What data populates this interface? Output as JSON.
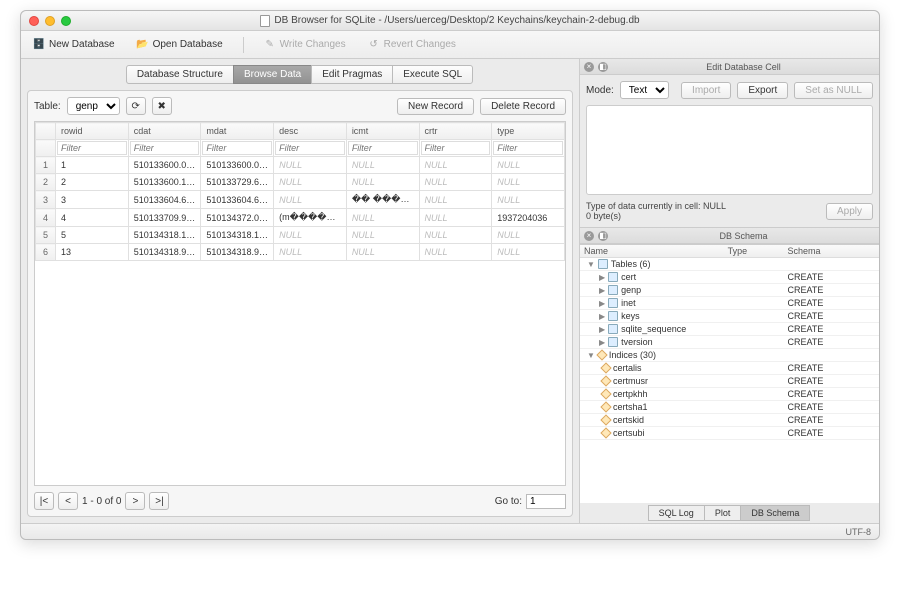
{
  "window": {
    "title": "DB Browser for SQLite - /Users/uerceg/Desktop/2 Keychains/keychain-2-debug.db"
  },
  "toolbar": {
    "new_db": "New Database",
    "open_db": "Open Database",
    "write_changes": "Write Changes",
    "revert_changes": "Revert Changes"
  },
  "tabs": {
    "structure": "Database Structure",
    "browse": "Browse Data",
    "pragmas": "Edit Pragmas",
    "sql": "Execute SQL"
  },
  "browse": {
    "table_label": "Table:",
    "table_selected": "genp",
    "new_record": "New Record",
    "delete_record": "Delete Record",
    "filter_placeholder": "Filter",
    "columns": [
      "rowid",
      "cdat",
      "mdat",
      "desc",
      "icmt",
      "crtr",
      "type"
    ],
    "rows": [
      {
        "idx": "1",
        "rowid": "1",
        "cdat": "510133600.06…",
        "mdat": "510133600.06…",
        "desc": null,
        "icmt": null,
        "crtr": null,
        "type": null
      },
      {
        "idx": "2",
        "rowid": "2",
        "cdat": "510133600.18…",
        "mdat": "510133729.60…",
        "desc": null,
        "icmt": null,
        "crtr": null,
        "type": null
      },
      {
        "idx": "3",
        "rowid": "3",
        "cdat": "510133604.63…",
        "mdat": "510133604.63…",
        "desc": null,
        "icmt": "�� �����z…",
        "crtr": null,
        "type": null
      },
      {
        "idx": "4",
        "rowid": "4",
        "cdat": "510133709.96…",
        "mdat": "510134372.06…",
        "desc": "(m����� �…",
        "icmt": null,
        "crtr": null,
        "type": "1937204036"
      },
      {
        "idx": "5",
        "rowid": "5",
        "cdat": "510134318.14…",
        "mdat": "510134318.14…",
        "desc": null,
        "icmt": null,
        "crtr": null,
        "type": null
      },
      {
        "idx": "6",
        "rowid": "13",
        "cdat": "510134318.95…",
        "mdat": "510134318.95…",
        "desc": null,
        "icmt": null,
        "crtr": null,
        "type": null
      }
    ],
    "null_text": "NULL",
    "pager": {
      "first": "|<",
      "prev": "<",
      "status": "1 - 0 of 0",
      "next": ">",
      "last": ">|",
      "goto_label": "Go to:",
      "goto_value": "1"
    }
  },
  "editcell": {
    "title": "Edit Database Cell",
    "mode_label": "Mode:",
    "mode_value": "Text",
    "import": "Import",
    "export": "Export",
    "set_null": "Set as NULL",
    "type_info": "Type of data currently in cell: NULL",
    "size_info": "0 byte(s)",
    "apply": "Apply"
  },
  "schema": {
    "title": "DB Schema",
    "cols": {
      "name": "Name",
      "type": "Type",
      "schema": "Schema"
    },
    "tables_label": "Tables (6)",
    "indices_label": "Indices (30)",
    "tables": [
      "cert",
      "genp",
      "inet",
      "keys",
      "sqlite_sequence",
      "tversion"
    ],
    "indices": [
      "certalis",
      "certmusr",
      "certpkhh",
      "certsha1",
      "certskid",
      "certsubi"
    ],
    "create_text": "CREATE"
  },
  "bottom_tabs": {
    "sql_log": "SQL Log",
    "plot": "Plot",
    "db_schema": "DB Schema"
  },
  "statusbar": {
    "encoding": "UTF-8"
  }
}
